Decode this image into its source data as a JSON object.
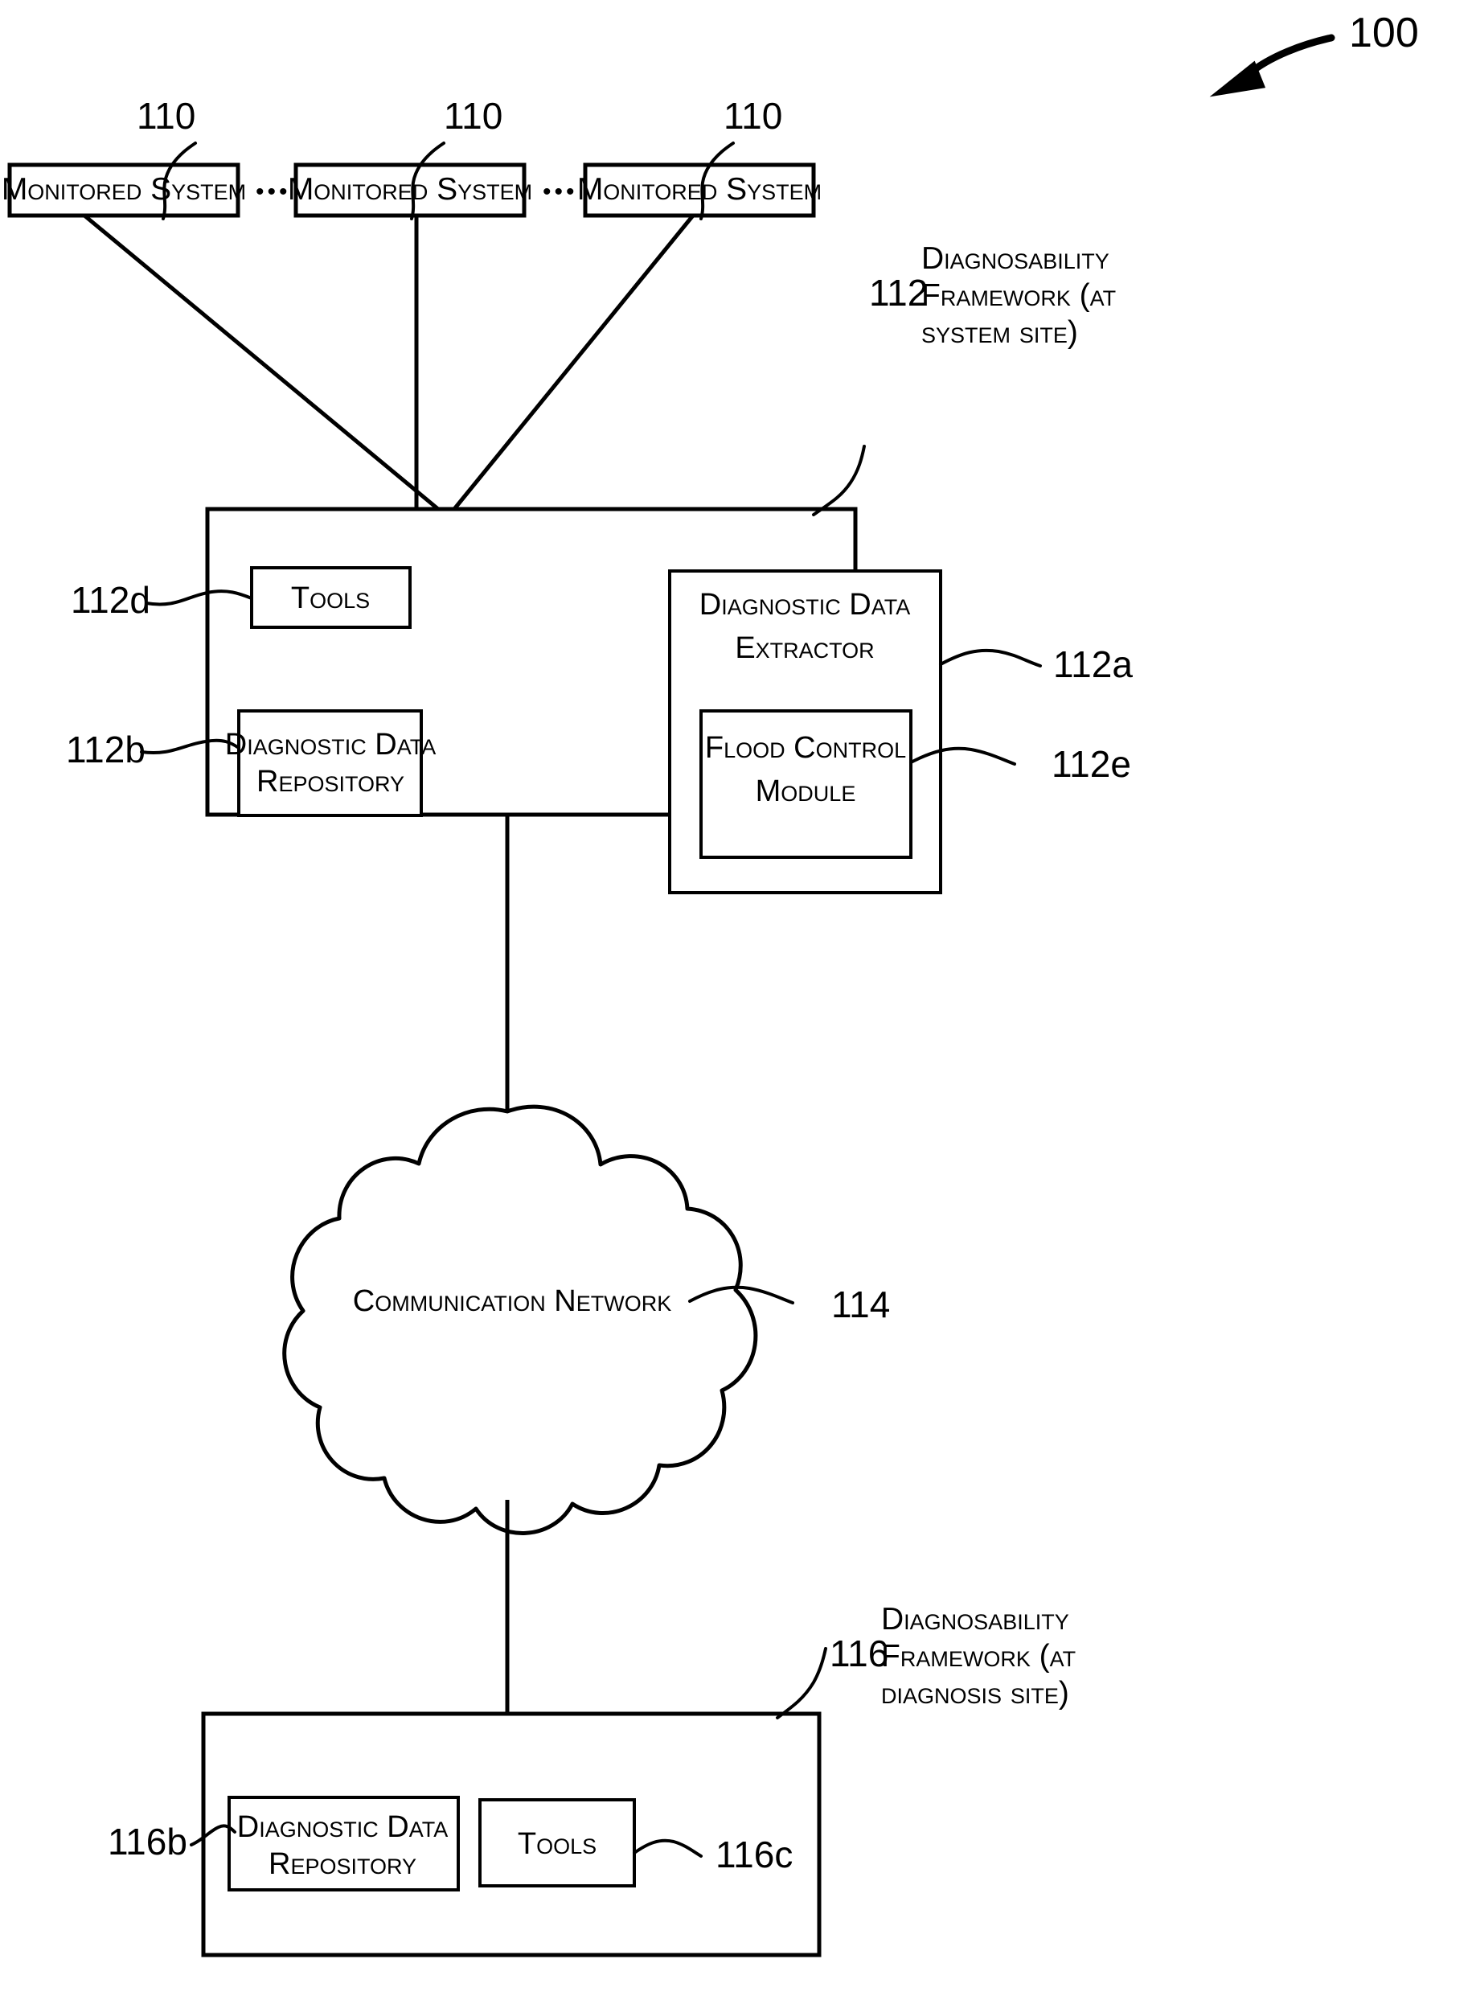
{
  "figure": {
    "figure_ref": "100",
    "monitored_systems": [
      {
        "label": "Monitored System",
        "ref": "110"
      },
      {
        "label": "Monitored System",
        "ref": "110"
      },
      {
        "label": "Monitored System",
        "ref": "110"
      }
    ],
    "ellipsis": "•••",
    "system_site": {
      "ref": "112",
      "caption_line1": "Diagnosability",
      "caption_line2": "Framework (at",
      "caption_line3": "system site)",
      "tools": {
        "label": "Tools",
        "ref": "112d"
      },
      "repository": {
        "label_line1": "Diagnostic Data",
        "label_line2": "Repository",
        "ref": "112b"
      },
      "extractor": {
        "label_line1": "Diagnostic Data",
        "label_line2": "Extractor",
        "ref": "112a"
      },
      "flood_control": {
        "label_line1": "Flood Control",
        "label_line2": "Module",
        "ref": "112e"
      }
    },
    "network": {
      "label": "Communication Network",
      "ref": "114"
    },
    "diagnosis_site": {
      "ref": "116",
      "caption_line1": "Diagnosability",
      "caption_line2": "Framework (at",
      "caption_line3": "diagnosis site)",
      "repository": {
        "label_line1": "Diagnostic Data",
        "label_line2": "Repository",
        "ref": "116b"
      },
      "tools": {
        "label": "Tools",
        "ref": "116c"
      }
    },
    "colors": {
      "ink": "#000000",
      "paper": "#ffffff"
    }
  }
}
